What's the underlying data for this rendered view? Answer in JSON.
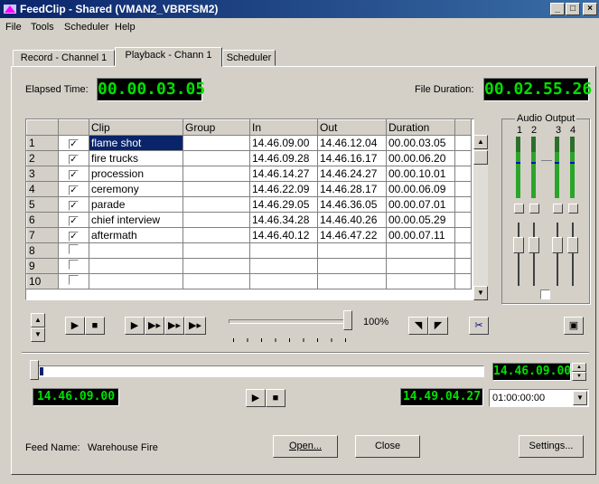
{
  "window": {
    "title": "FeedClip - Shared (VMAN2_VBRFSM2)"
  },
  "menu": [
    "File",
    "Tools",
    "Scheduler",
    "Help"
  ],
  "tabs": [
    "Record - Channel 1",
    "Playback - Chann   1",
    "Scheduler"
  ],
  "elapsed": {
    "label": "Elapsed Time:",
    "value": "00.00.03.05"
  },
  "duration": {
    "label": "File Duration:",
    "value": "00.02.55.26"
  },
  "table": {
    "headers": [
      "Clip",
      "Group",
      "In",
      "Out",
      "Duration"
    ],
    "rows": [
      {
        "n": "1",
        "checked": true,
        "clip": "flame shot",
        "group": "",
        "in": "14.46.09.00",
        "out": "14.46.12.04",
        "dur": "00.00.03.05"
      },
      {
        "n": "2",
        "checked": true,
        "clip": "fire trucks",
        "group": "",
        "in": "14.46.09.28",
        "out": "14.46.16.17",
        "dur": "00.00.06.20"
      },
      {
        "n": "3",
        "checked": true,
        "clip": "procession",
        "group": "",
        "in": "14.46.14.27",
        "out": "14.46.24.27",
        "dur": "00.00.10.01"
      },
      {
        "n": "4",
        "checked": true,
        "clip": "ceremony",
        "group": "",
        "in": "14.46.22.09",
        "out": "14.46.28.17",
        "dur": "00.00.06.09"
      },
      {
        "n": "5",
        "checked": true,
        "clip": "parade",
        "group": "",
        "in": "14.46.29.05",
        "out": "14.46.36.05",
        "dur": "00.00.07.01"
      },
      {
        "n": "6",
        "checked": true,
        "clip": "chief interview",
        "group": "",
        "in": "14.46.34.28",
        "out": "14.46.40.26",
        "dur": "00.00.05.29"
      },
      {
        "n": "7",
        "checked": true,
        "clip": "aftermath",
        "group": "",
        "in": "14.46.40.12",
        "out": "14.46.47.22",
        "dur": "00.00.07.11"
      },
      {
        "n": "8",
        "checked": false,
        "clip": "",
        "group": "",
        "in": "",
        "out": "",
        "dur": ""
      },
      {
        "n": "9",
        "checked": false,
        "clip": "",
        "group": "",
        "in": "",
        "out": "",
        "dur": ""
      },
      {
        "n": "10",
        "checked": false,
        "clip": "",
        "group": "",
        "in": "",
        "out": "",
        "dur": ""
      }
    ]
  },
  "audio": {
    "title": "Audio Output",
    "channels": [
      "1",
      "2",
      "3",
      "4"
    ]
  },
  "speed": {
    "percent": "100%"
  },
  "transport": {
    "current_tc": "14.46.09.00",
    "in_tc": "14.46.09.00",
    "out_tc": "14.49.04.27",
    "jump_value": "01:00:00:00"
  },
  "feed": {
    "label": "Feed Name:",
    "name": "Warehouse Fire"
  },
  "buttons": {
    "open": "Open...",
    "close": "Close",
    "settings": "Settings..."
  },
  "colors": {
    "title_start": "#0a246a",
    "title_end": "#3a6ea5",
    "lcd_bg": "#000000",
    "lcd_text": "#00e000",
    "selection": "#0a246a"
  }
}
